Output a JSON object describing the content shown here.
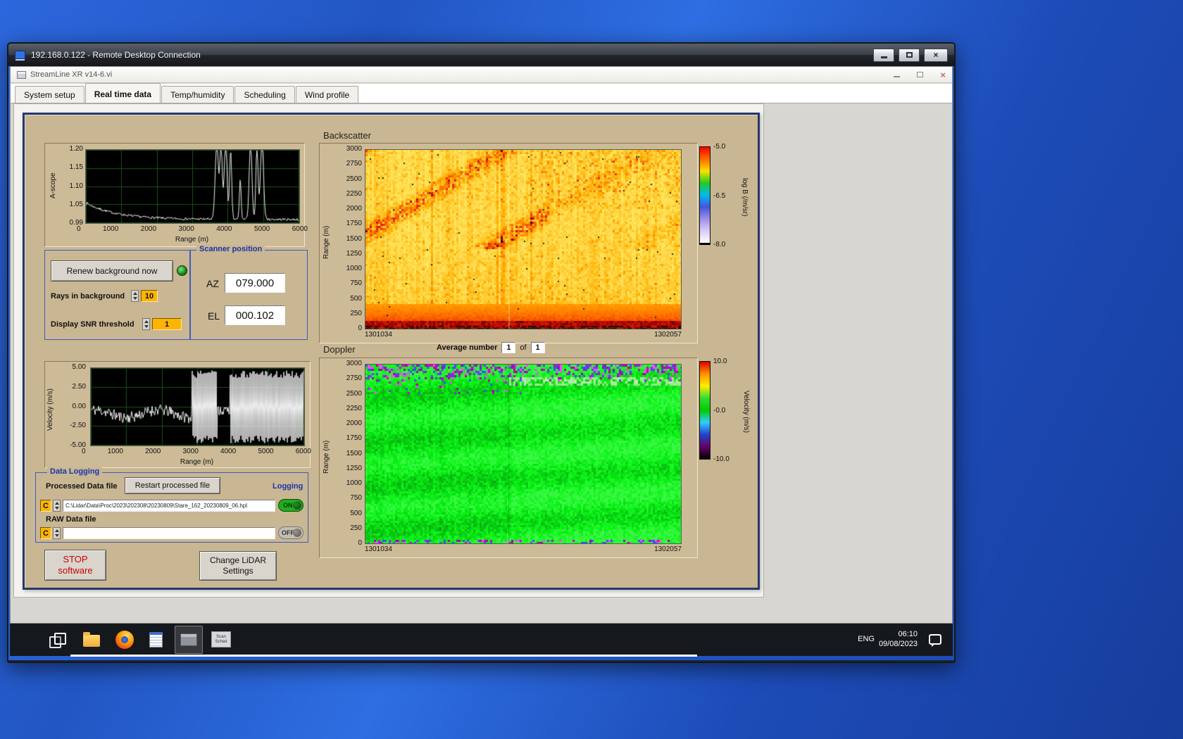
{
  "icons": {
    "close": "×"
  },
  "rdp": {
    "title": "192.168.0.122 - Remote Desktop Connection"
  },
  "app": {
    "title": "StreamLine XR v14-6.vi",
    "tabs": [
      {
        "label": "System setup"
      },
      {
        "label": "Real time data"
      },
      {
        "label": "Temp/humidity"
      },
      {
        "label": "Scheduling"
      },
      {
        "label": "Wind profile"
      }
    ]
  },
  "ascope": {
    "ylabel": "A-scope",
    "xlabel": "Range (m)",
    "yticks": [
      "1.20",
      "1.15",
      "1.10",
      "1.05",
      "0.99"
    ],
    "xticks": [
      "0",
      "1000",
      "2000",
      "3000",
      "4000",
      "5000",
      "6000"
    ]
  },
  "controls": {
    "renew_label": "Renew background now",
    "rays_label": "Rays in background",
    "rays_value": "10",
    "snr_label": "Display SNR threshold",
    "snr_value": "1"
  },
  "scanner": {
    "title": "Scanner position",
    "az_label": "AZ",
    "az_value": "079.000",
    "el_label": "EL",
    "el_value": "000.102"
  },
  "backscatter": {
    "title": "Backscatter",
    "ylabel": "Range (m)",
    "yticks": [
      "3000",
      "2750",
      "2500",
      "2250",
      "2000",
      "1750",
      "1500",
      "1250",
      "1000",
      "750",
      "500",
      "250",
      "0"
    ],
    "t_start": "1301034",
    "t_end": "1302057",
    "cb_ticks": [
      "-5.0",
      "-6.5",
      "-8.0"
    ],
    "cb_label": "log B (/m/sr)"
  },
  "doppler": {
    "title": "Doppler",
    "avg_label": "Average number",
    "avg_value": "1",
    "of_label": "of",
    "avg_total": "1",
    "ylabel": "Range (m)",
    "yticks": [
      "3000",
      "2750",
      "2500",
      "2250",
      "2000",
      "1750",
      "1500",
      "1250",
      "1000",
      "750",
      "500",
      "250",
      "0"
    ],
    "t_start": "1301034",
    "t_end": "1302057",
    "cb_ticks": [
      "10.0",
      "-0.0",
      "-10.0"
    ],
    "cb_label": "Velocity (m/s)"
  },
  "velscope": {
    "ylabel": "Velocity (m/s)",
    "xlabel": "Range (m)",
    "yticks": [
      "5.00",
      "2.50",
      "0.00",
      "-2.50",
      "-5.00"
    ],
    "xticks": [
      "0",
      "1000",
      "2000",
      "3000",
      "4000",
      "5000",
      "6000"
    ]
  },
  "logging": {
    "title": "Data Logging",
    "processed_label": "Processed Data file",
    "restart_button": "Restart processed file",
    "logging_label": "Logging",
    "drive": "C",
    "processed_path": "C:\\Lidar\\Data\\Proc\\2023\\202308\\20230809\\Stare_162_20230809_06.hpl",
    "raw_label": "RAW Data file",
    "raw_path": "",
    "on_label": "ON",
    "off_label": "OFF"
  },
  "actions": {
    "stop1": "STOP",
    "stop2": "software",
    "change1": "Change LiDAR",
    "change2": "Settings"
  },
  "taskbar": {
    "lang": "ENG",
    "time": "06:10",
    "date": "09/08/2023",
    "scan1": "Scan",
    "scan2": "Sched"
  },
  "colorbars": {
    "backscatter": [
      "#ff0000",
      "#ff6a00",
      "#ffe000",
      "#22cc22",
      "#00bbee",
      "#4455dd",
      "#9f8fe8",
      "#d9ccf6",
      "#ffffff"
    ],
    "doppler": [
      "#e00000",
      "#ff9000",
      "#ffee00",
      "#33dd33",
      "#00cc00",
      "#33ccff",
      "#2244cc",
      "#660066",
      "#000000"
    ]
  },
  "plots": {
    "ascope": {
      "seed": 7,
      "spikes": [
        [
          3680,
          0.22,
          45
        ],
        [
          3800,
          0.21,
          35
        ],
        [
          3930,
          0.23,
          40
        ],
        [
          4070,
          0.2,
          30
        ],
        [
          4340,
          0.12,
          25
        ],
        [
          4630,
          0.22,
          40
        ],
        [
          4810,
          0.21,
          30
        ],
        [
          4950,
          0.23,
          45
        ]
      ]
    },
    "velocity": {
      "seed": 11,
      "dense_start": 2780
    },
    "backscatter": {
      "seed": 3,
      "stops": [
        [
          0,
          "#140000"
        ],
        [
          0.08,
          "#a00000"
        ],
        [
          0.22,
          "#e82800"
        ],
        [
          0.42,
          "#ff7800"
        ],
        [
          0.62,
          "#ffb000"
        ],
        [
          0.85,
          "#ffd84a"
        ],
        [
          1,
          "#ffe860"
        ]
      ]
    },
    "doppler": {
      "seed": 5
    }
  }
}
